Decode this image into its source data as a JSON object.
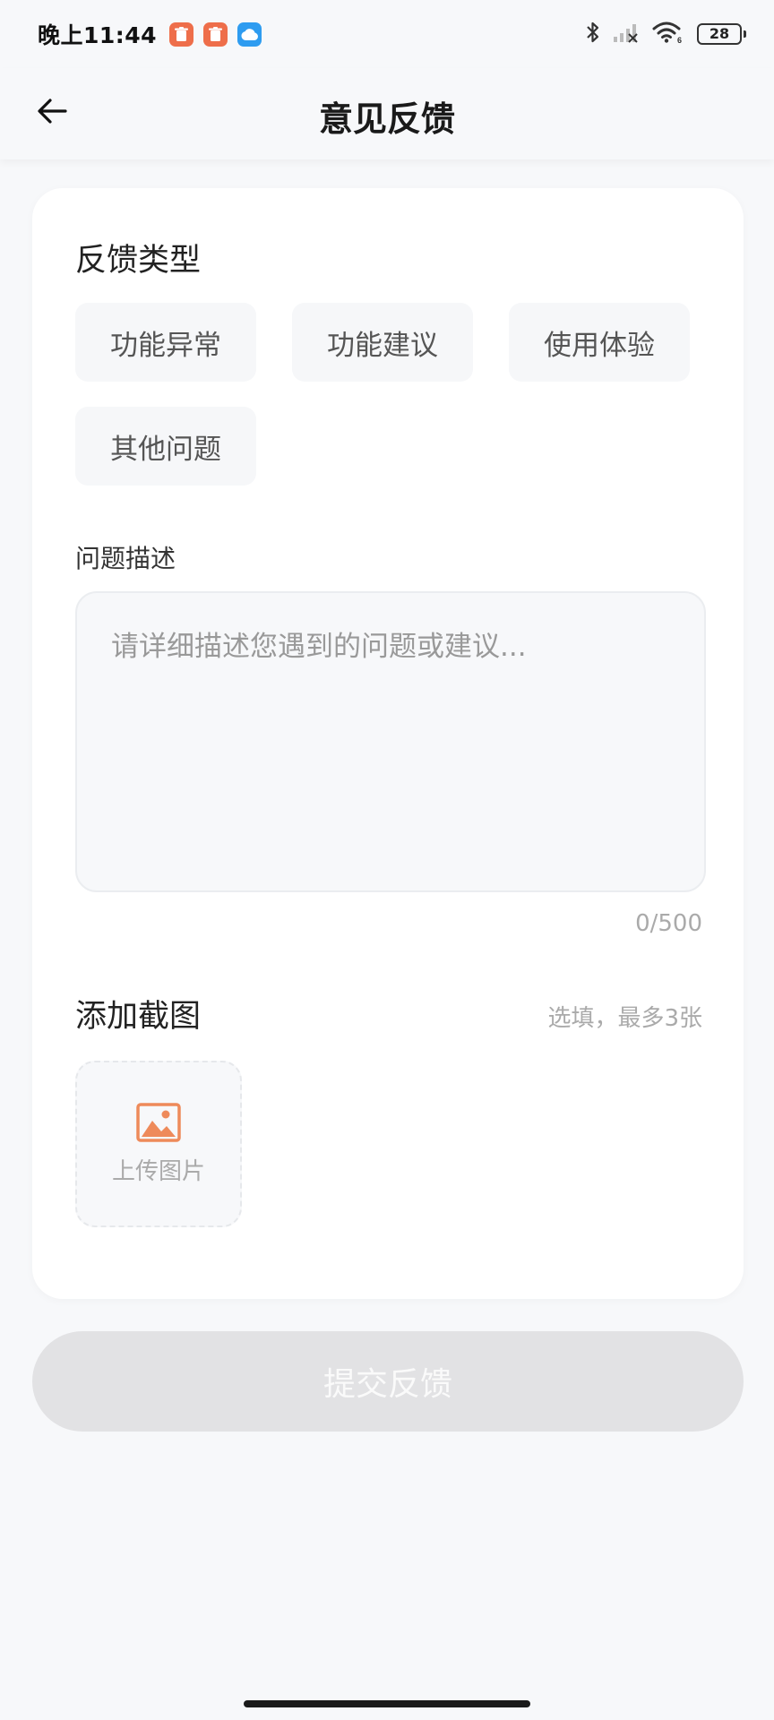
{
  "status_bar": {
    "time": "晚上11:44",
    "battery": "28",
    "app_icons": [
      "orange-trash-app-icon",
      "orange-trash-app-icon",
      "blue-cloud-app-icon"
    ],
    "accent_orange": "#ee6e4a",
    "accent_blue": "#2e9cf0"
  },
  "header": {
    "title": "意见反馈"
  },
  "feedback_type": {
    "title": "反馈类型",
    "options": [
      "功能异常",
      "功能建议",
      "使用体验",
      "其他问题"
    ]
  },
  "description": {
    "label": "问题描述",
    "placeholder": "请详细描述您遇到的问题或建议...",
    "value": "",
    "counter": "0/500"
  },
  "screenshot": {
    "title": "添加截图",
    "hint": "选填，最多3张",
    "upload_label": "上传图片",
    "icon_color": "#ee8a5a"
  },
  "submit": {
    "label": "提交反馈",
    "enabled": false
  }
}
